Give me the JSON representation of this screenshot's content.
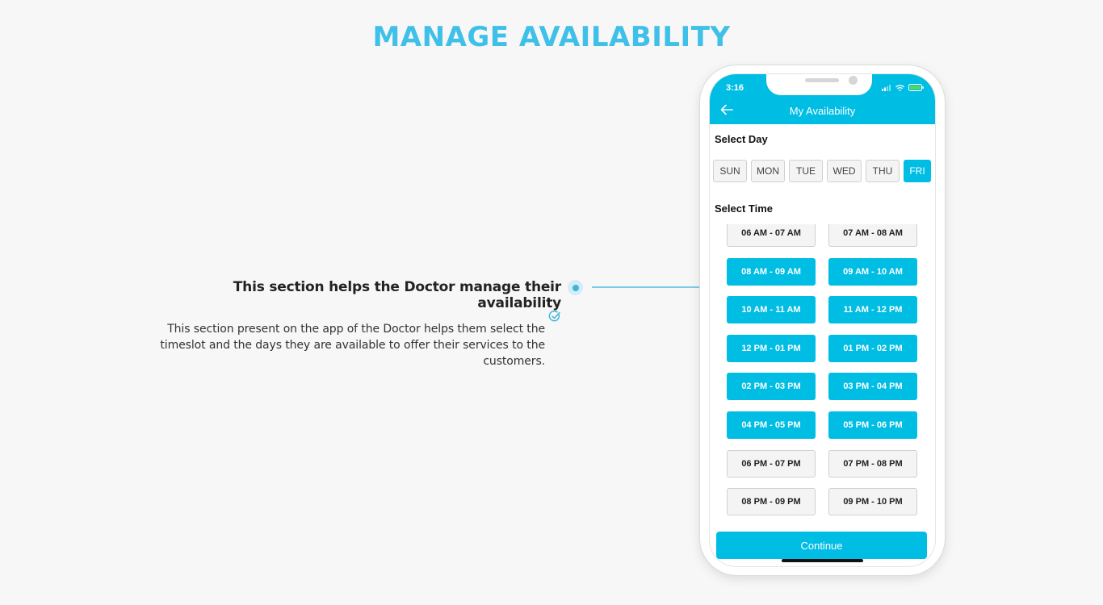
{
  "page": {
    "title": "MANAGE AVAILABILITY"
  },
  "feature": {
    "heading": "This section helps the Doctor manage their availability",
    "description": "This section present on the app of the Doctor helps them select the timeslot and the days they are available to offer their services to the customers.",
    "check_icon": "check-circle-icon"
  },
  "colors": {
    "accent": "#00bde4",
    "title": "#3fc0e8"
  },
  "phone": {
    "status_time": "3:16",
    "header_title": "My Availability",
    "select_day_label": "Select Day",
    "select_time_label": "Select Time",
    "days": [
      {
        "label": "SUN",
        "selected": false
      },
      {
        "label": "MON",
        "selected": false
      },
      {
        "label": "TUE",
        "selected": false
      },
      {
        "label": "WED",
        "selected": false
      },
      {
        "label": "THU",
        "selected": false
      },
      {
        "label": "FRI",
        "selected": true
      }
    ],
    "slots": [
      {
        "label": "06 AM - 07 AM",
        "selected": false
      },
      {
        "label": "07 AM - 08 AM",
        "selected": false
      },
      {
        "label": "08 AM - 09 AM",
        "selected": true
      },
      {
        "label": "09 AM - 10 AM",
        "selected": true
      },
      {
        "label": "10 AM - 11 AM",
        "selected": true
      },
      {
        "label": "11 AM - 12 PM",
        "selected": true
      },
      {
        "label": "12 PM - 01 PM",
        "selected": true
      },
      {
        "label": "01 PM - 02 PM",
        "selected": true
      },
      {
        "label": "02 PM - 03 PM",
        "selected": true
      },
      {
        "label": "03 PM - 04 PM",
        "selected": true
      },
      {
        "label": "04 PM - 05 PM",
        "selected": true
      },
      {
        "label": "05 PM - 06 PM",
        "selected": true
      },
      {
        "label": "06 PM - 07 PM",
        "selected": false
      },
      {
        "label": "07 PM - 08 PM",
        "selected": false
      },
      {
        "label": "08 PM - 09 PM",
        "selected": false
      },
      {
        "label": "09 PM - 10 PM",
        "selected": false
      }
    ],
    "continue_label": "Continue"
  }
}
